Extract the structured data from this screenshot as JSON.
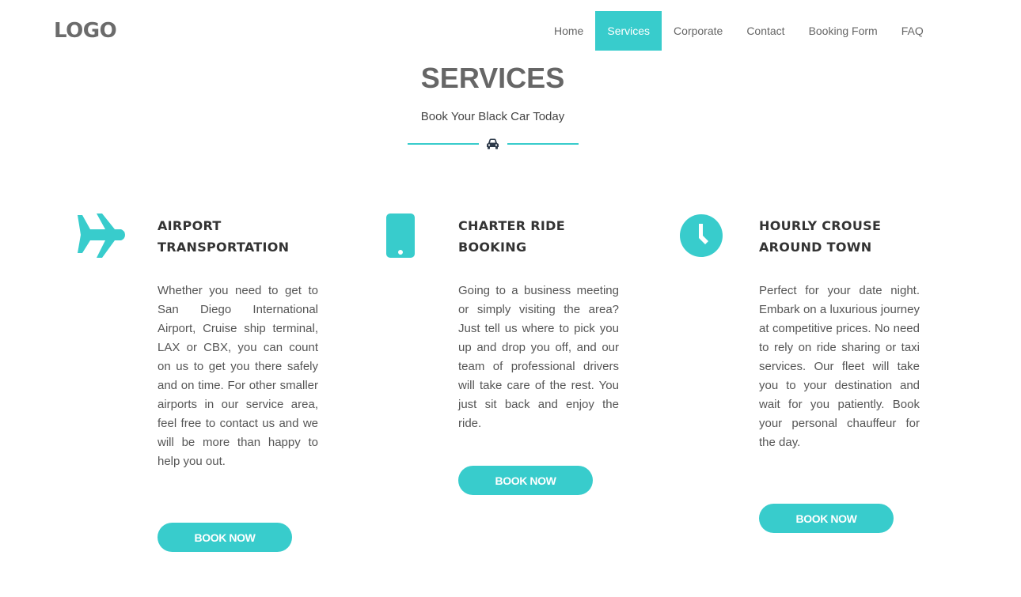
{
  "brand": {
    "logo": "LOGO"
  },
  "nav": {
    "items": [
      {
        "label": "Home"
      },
      {
        "label": "Services",
        "active": true
      },
      {
        "label": "Corporate"
      },
      {
        "label": "Contact"
      },
      {
        "label": "Booking Form"
      },
      {
        "label": "FAQ"
      }
    ]
  },
  "header": {
    "title": "SERVICES",
    "subtitle": "Book Your Black Car Today",
    "divider_icon": "car-icon"
  },
  "services": [
    {
      "icon": "airplane-icon",
      "title_line1": "AIRPORT",
      "title_line2": "TRANSPORTATION",
      "text": "Whether you need to get to San Diego International Airport, Cruise ship terminal, LAX or CBX, you can count on us to get you there safely and on time. For other smaller airports in our service area, feel free to contact us and we will be more than happy to help you out.",
      "button": "BOOK NOW"
    },
    {
      "icon": "smartphone-icon",
      "title_line1": "CHARTER RIDE",
      "title_line2": "BOOKING",
      "text": "Going to a business meeting or simply visiting the area? Just tell us where to pick you up and drop you off, and our team of professional drivers will take care of the rest. You just sit back and enjoy the ride.",
      "button": "BOOK NOW"
    },
    {
      "icon": "clock-icon",
      "title_line1": "HOURLY CROUSE",
      "title_line2": "AROUND TOWN",
      "text": "Perfect for your date night. Embark on a luxurious journey at competitive prices. No need to rely on ride sharing or taxi services. Our fleet will take you to your destination and wait for you patiently. Book your personal chauffeur for the day.",
      "button": "BOOK NOW"
    }
  ],
  "colors": {
    "accent": "#38cccc",
    "heading": "#666666",
    "text": "#555555"
  }
}
